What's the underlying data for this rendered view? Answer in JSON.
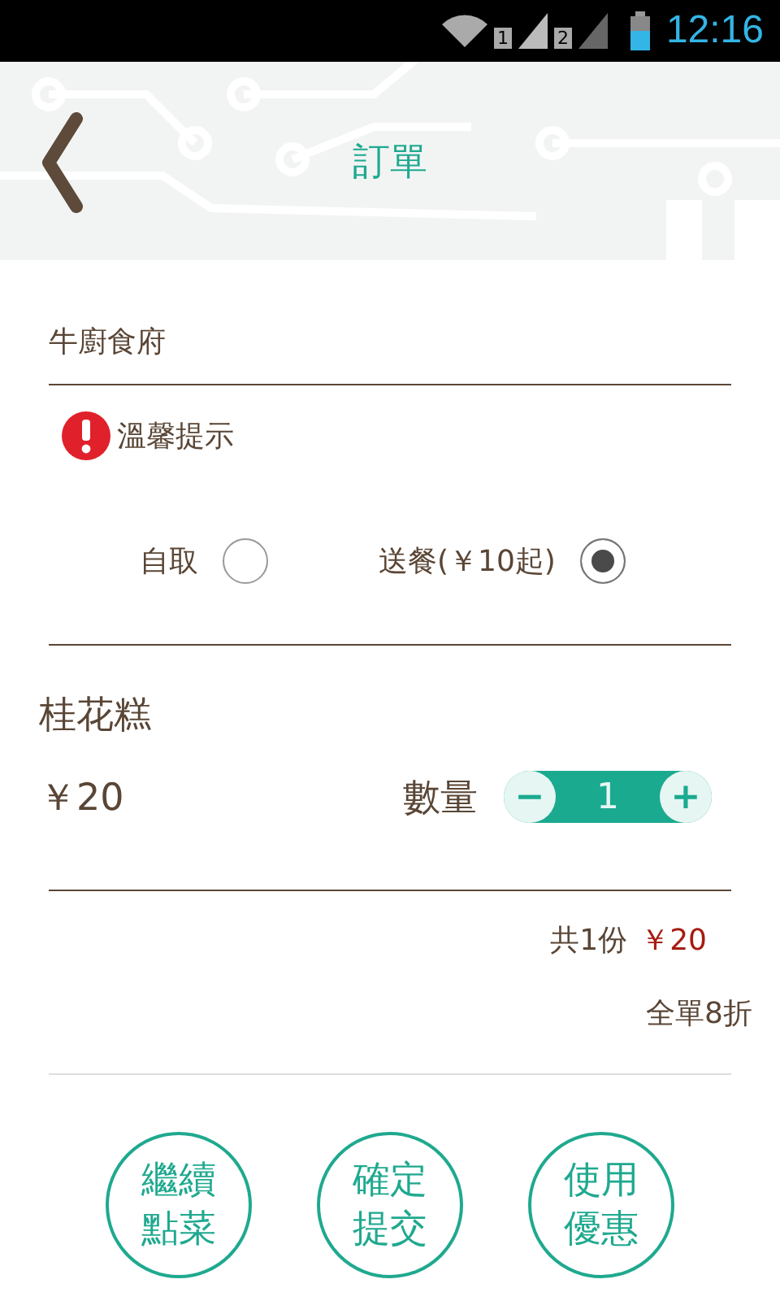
{
  "status_bar": {
    "sim_labels": [
      "1",
      "2"
    ],
    "time": "12:16"
  },
  "header": {
    "title": "訂單"
  },
  "shop": {
    "name": "牛廚食府"
  },
  "notice": {
    "label": "溫馨提示"
  },
  "delivery_options": [
    {
      "label": "自取",
      "selected": false
    },
    {
      "label": "送餐(￥10起)",
      "selected": true
    }
  ],
  "item": {
    "name": "桂花糕",
    "price": "￥20",
    "quantity_label": "數量",
    "decrement": "−",
    "quantity": "1",
    "increment": "+"
  },
  "summary": {
    "count": "共1份",
    "total": "￥20",
    "discount": "全單8折"
  },
  "buttons": [
    {
      "label": "繼續點菜"
    },
    {
      "label": "確定提交"
    },
    {
      "label": "使用優惠"
    }
  ]
}
